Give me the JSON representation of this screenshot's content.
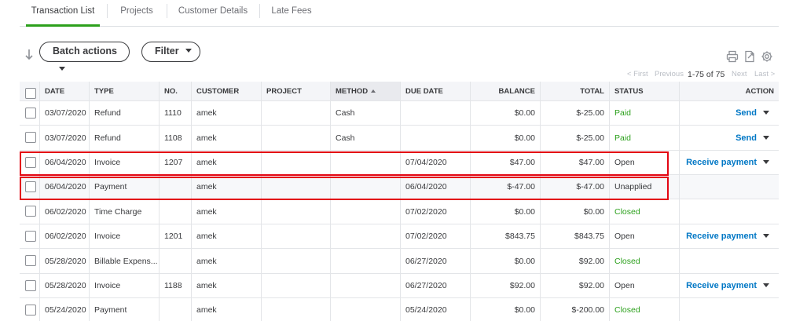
{
  "tabs": [
    {
      "label": "Transaction List",
      "active": true
    },
    {
      "label": "Projects",
      "active": false
    },
    {
      "label": "Customer Details",
      "active": false
    },
    {
      "label": "Late Fees",
      "active": false
    }
  ],
  "toolbar": {
    "batch_actions_label": "Batch actions",
    "filter_label": "Filter"
  },
  "pager": {
    "first": "< First",
    "previous": "Previous",
    "range": "1-75 of 75",
    "next": "Next",
    "last": "Last >"
  },
  "columns": {
    "date": "DATE",
    "type": "TYPE",
    "no": "NO.",
    "customer": "CUSTOMER",
    "project": "PROJECT",
    "method": "METHOD",
    "due_date": "DUE DATE",
    "balance": "BALANCE",
    "total": "TOTAL",
    "status": "STATUS",
    "action": "ACTION"
  },
  "rows": [
    {
      "date": "03/07/2020",
      "type": "Refund",
      "no": "1110",
      "customer": "amek",
      "project": "",
      "method": "Cash",
      "due_date": "",
      "balance": "$0.00",
      "total": "$-25.00",
      "status": "Paid",
      "action": "Send"
    },
    {
      "date": "03/07/2020",
      "type": "Refund",
      "no": "1108",
      "customer": "amek",
      "project": "",
      "method": "Cash",
      "due_date": "",
      "balance": "$0.00",
      "total": "$-25.00",
      "status": "Paid",
      "action": "Send"
    },
    {
      "date": "06/04/2020",
      "type": "Invoice",
      "no": "1207",
      "customer": "amek",
      "project": "",
      "method": "",
      "due_date": "07/04/2020",
      "balance": "$47.00",
      "total": "$47.00",
      "status": "Open",
      "action": "Receive payment"
    },
    {
      "date": "06/04/2020",
      "type": "Payment",
      "no": "",
      "customer": "amek",
      "project": "",
      "method": "",
      "due_date": "06/04/2020",
      "balance": "$-47.00",
      "total": "$-47.00",
      "status": "Unapplied",
      "action": ""
    },
    {
      "date": "06/02/2020",
      "type": "Time Charge",
      "no": "",
      "customer": "amek",
      "project": "",
      "method": "",
      "due_date": "07/02/2020",
      "balance": "$0.00",
      "total": "$0.00",
      "status": "Closed",
      "action": ""
    },
    {
      "date": "06/02/2020",
      "type": "Invoice",
      "no": "1201",
      "customer": "amek",
      "project": "",
      "method": "",
      "due_date": "07/02/2020",
      "balance": "$843.75",
      "total": "$843.75",
      "status": "Open",
      "action": "Receive payment"
    },
    {
      "date": "05/28/2020",
      "type": "Billable Expens...",
      "no": "",
      "customer": "amek",
      "project": "",
      "method": "",
      "due_date": "06/27/2020",
      "balance": "$0.00",
      "total": "$92.00",
      "status": "Closed",
      "action": ""
    },
    {
      "date": "05/28/2020",
      "type": "Invoice",
      "no": "1188",
      "customer": "amek",
      "project": "",
      "method": "",
      "due_date": "06/27/2020",
      "balance": "$92.00",
      "total": "$92.00",
      "status": "Open",
      "action": "Receive payment"
    },
    {
      "date": "05/24/2020",
      "type": "Payment",
      "no": "",
      "customer": "amek",
      "project": "",
      "method": "",
      "due_date": "05/24/2020",
      "balance": "$0.00",
      "total": "$-200.00",
      "status": "Closed",
      "action": ""
    }
  ],
  "colors": {
    "accent_green": "#2ca01c",
    "link_blue": "#0077c5",
    "highlight_red": "#e30613"
  },
  "icons": {
    "sort": "sort-arrow-icon",
    "print": "print-icon",
    "export": "export-icon",
    "settings": "gear-icon"
  }
}
